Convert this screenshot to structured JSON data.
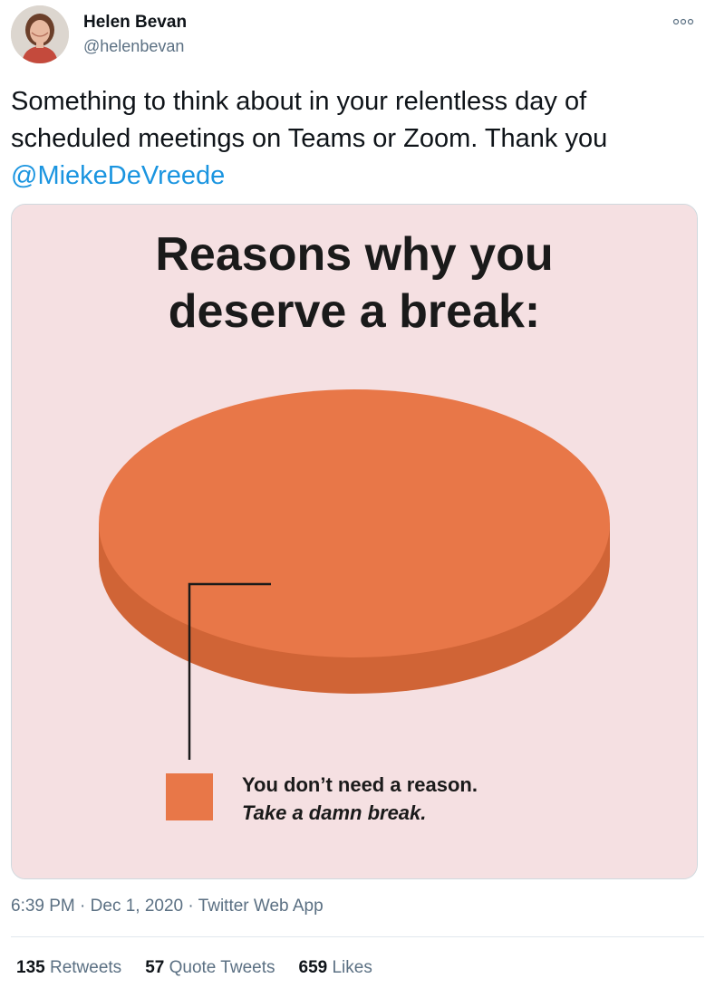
{
  "author": {
    "name": "Helen Bevan",
    "handle": "@helenbevan",
    "avatar_icon": "user-avatar-photo"
  },
  "more_icon": "more-options-icon",
  "tweet": {
    "text_before": "Something to think about in your relentless day of scheduled meetings on Teams or Zoom. Thank you ",
    "mention": "@MiekeDeVreede"
  },
  "image": {
    "title_line1": "Reasons why you",
    "title_line2": "deserve a break:",
    "legend_line1": "You don’t need a reason.",
    "legend_line2": "Take a damn break.",
    "background_color": "#f5e0e2",
    "pie_color": "#e87748",
    "pie_side_color": "#d06436"
  },
  "chart_data": {
    "type": "pie",
    "title": "Reasons why you deserve a break:",
    "categories": [
      "You don’t need a reason. Take a damn break."
    ],
    "values": [
      100
    ],
    "legend": "bottom"
  },
  "meta": {
    "time": "6:39 PM",
    "separator": "·",
    "date": "Dec 1, 2020",
    "source": "Twitter Web App"
  },
  "stats": {
    "retweets_count": "135",
    "retweets_label": "Retweets",
    "quotes_count": "57",
    "quotes_label": "Quote Tweets",
    "likes_count": "659",
    "likes_label": "Likes"
  },
  "colors": {
    "link": "#1b95e0",
    "secondary_text": "#5b7083",
    "primary_text": "#0f1419"
  }
}
